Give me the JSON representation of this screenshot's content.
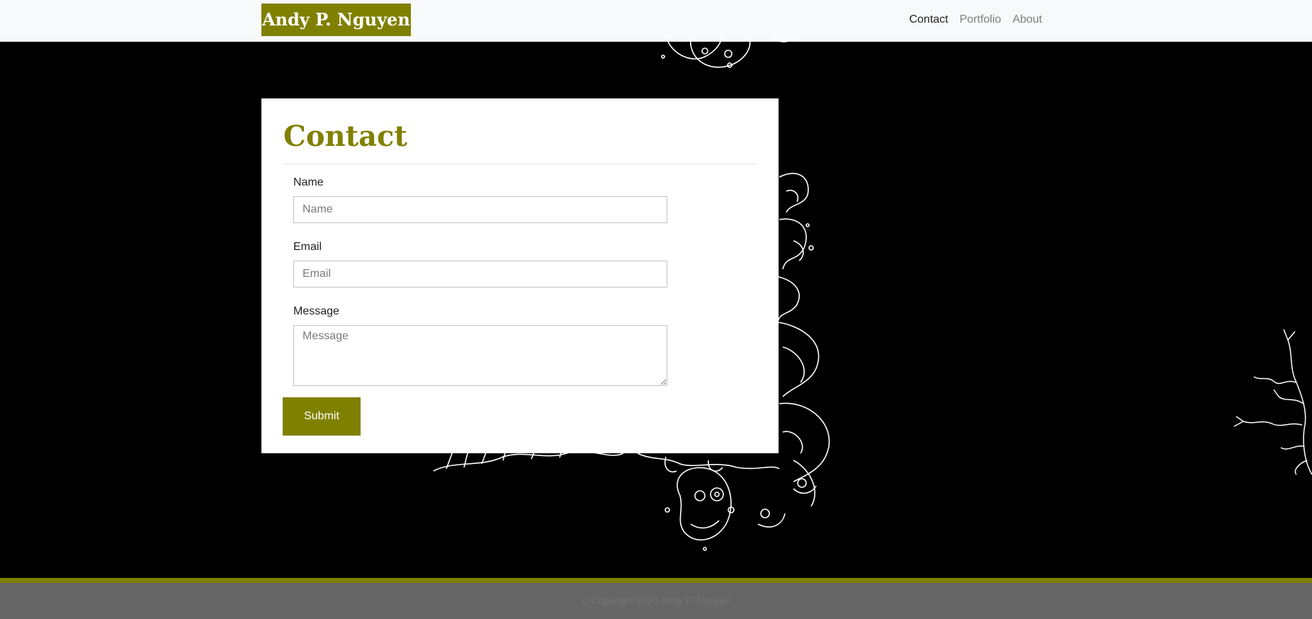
{
  "nav": {
    "brand": "Andy P. Nguyen",
    "links": [
      {
        "label": "Contact",
        "active": true
      },
      {
        "label": "Portfolio",
        "active": false
      },
      {
        "label": "About",
        "active": false
      }
    ]
  },
  "contact": {
    "title": "Contact",
    "fields": {
      "name": {
        "label": "Name",
        "placeholder": "Name"
      },
      "email": {
        "label": "Email",
        "placeholder": "Email"
      },
      "message": {
        "label": "Message",
        "placeholder": "Message"
      }
    },
    "submit_label": "Submit"
  },
  "footer": {
    "text": "© Copyright 2020 Andy P. Nguyen"
  },
  "colors": {
    "accent": "#808000",
    "page_bg": "#000000",
    "navbar_bg": "#f8f9fa",
    "footer_bg": "#666666"
  },
  "background_art": [
    "creature-illustration",
    "tree-illustration"
  ]
}
